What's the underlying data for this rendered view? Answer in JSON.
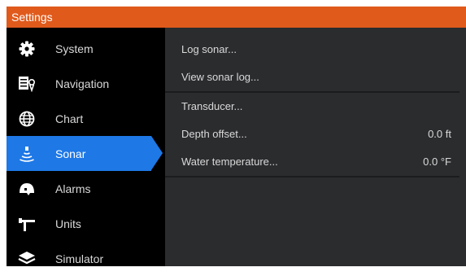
{
  "window": {
    "title": "Settings"
  },
  "sidebar": {
    "items": [
      {
        "label": "System",
        "icon": "gear-icon",
        "active": false
      },
      {
        "label": "Navigation",
        "icon": "navigation-icon",
        "active": false
      },
      {
        "label": "Chart",
        "icon": "globe-icon",
        "active": false
      },
      {
        "label": "Sonar",
        "icon": "sonar-icon",
        "active": true
      },
      {
        "label": "Alarms",
        "icon": "alarm-icon",
        "active": false
      },
      {
        "label": "Units",
        "icon": "units-icon",
        "active": false
      },
      {
        "label": "Simulator",
        "icon": "simulator-icon",
        "active": false
      }
    ]
  },
  "content": {
    "rows": [
      {
        "label": "Log sonar...",
        "value": ""
      },
      {
        "label": "View sonar log...",
        "value": ""
      },
      {
        "label": "Transducer...",
        "value": ""
      },
      {
        "label": "Depth offset...",
        "value": "0.0 ft"
      },
      {
        "label": "Water temperature...",
        "value": "0.0 °F"
      }
    ]
  },
  "colors": {
    "title_bar": "#e05a1c",
    "selected": "#1e78e6",
    "sidebar_bg": "#000000",
    "content_bg": "#2b2c2e"
  }
}
